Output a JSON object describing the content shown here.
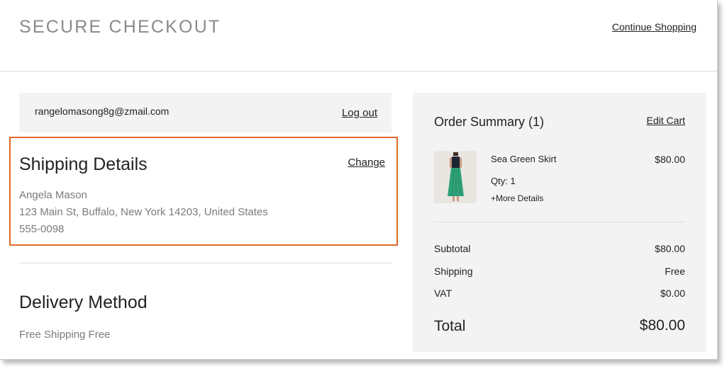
{
  "header": {
    "title": "SECURE CHECKOUT",
    "continue_label": "Continue Shopping"
  },
  "account": {
    "email": "rangelomasong8g@zmail.com",
    "logout_label": "Log out"
  },
  "shipping": {
    "title": "Shipping Details",
    "change_label": "Change",
    "name": "Angela Mason",
    "address": "123 Main St, Buffalo, New York 14203, United States",
    "phone": "555-0098",
    "highlight_color": "#e06a27"
  },
  "delivery": {
    "title": "Delivery Method",
    "value": "Free Shipping Free"
  },
  "summary": {
    "title": "Order Summary (1)",
    "edit_cart_label": "Edit Cart",
    "item": {
      "name": "Sea Green Skirt",
      "price": "$80.00",
      "qty": "Qty: 1",
      "more_details": "+More Details",
      "icon": "product-thumbnail"
    },
    "rows": [
      {
        "label": "Subtotal",
        "value": "$80.00"
      },
      {
        "label": "Shipping",
        "value": "Free"
      },
      {
        "label": "VAT",
        "value": "$0.00"
      }
    ],
    "total_label": "Total",
    "total_value": "$80.00"
  }
}
